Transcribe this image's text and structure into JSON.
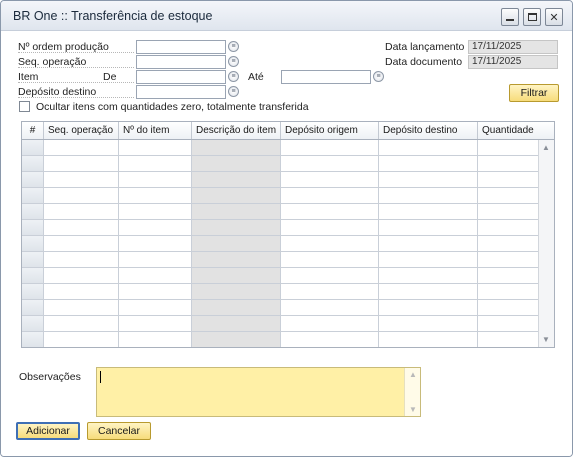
{
  "window": {
    "title": "BR One :: Transferência de estoque",
    "controls": [
      "minimize",
      "maximize",
      "close"
    ]
  },
  "form": {
    "ordem_label": "Nº ordem produção",
    "ordem_value": "",
    "seq_label": "Seq. operação",
    "seq_value": "",
    "item_label": "Item",
    "de_label": "De",
    "de_value": "",
    "ate_label": "Até",
    "ate_value": "",
    "deposito_label": "Depósito destino",
    "deposito_value": "",
    "data_lancamento_label": "Data lançamento",
    "data_lancamento_value": "17/11/2025",
    "data_documento_label": "Data documento",
    "data_documento_value": "17/11/2025",
    "ocultar_label": "Ocultar itens com quantidades zero, totalmente transferida",
    "ocultar_checked": false,
    "filtrar_label": "Filtrar"
  },
  "grid": {
    "columns": [
      "#",
      "Seq. operação",
      "Nº do item",
      "Descrição do item",
      "Depósito origem",
      "Depósito destino",
      "Quantidade"
    ],
    "rows": [
      [
        "",
        "",
        "",
        "",
        "",
        "",
        ""
      ],
      [
        "",
        "",
        "",
        "",
        "",
        "",
        ""
      ],
      [
        "",
        "",
        "",
        "",
        "",
        "",
        ""
      ],
      [
        "",
        "",
        "",
        "",
        "",
        "",
        ""
      ],
      [
        "",
        "",
        "",
        "",
        "",
        "",
        ""
      ],
      [
        "",
        "",
        "",
        "",
        "",
        "",
        ""
      ],
      [
        "",
        "",
        "",
        "",
        "",
        "",
        ""
      ],
      [
        "",
        "",
        "",
        "",
        "",
        "",
        ""
      ],
      [
        "",
        "",
        "",
        "",
        "",
        "",
        ""
      ],
      [
        "",
        "",
        "",
        "",
        "",
        "",
        ""
      ],
      [
        "",
        "",
        "",
        "",
        "",
        "",
        ""
      ],
      [
        "",
        "",
        "",
        "",
        "",
        "",
        ""
      ],
      [
        "",
        "",
        "",
        "",
        "",
        "",
        ""
      ]
    ]
  },
  "observacoes": {
    "label": "Observações",
    "value": ""
  },
  "buttons": {
    "adicionar": "Adicionar",
    "cancelar": "Cancelar"
  },
  "colors": {
    "button_gold": "#f7dc7b",
    "notes_yellow": "#fff0a6",
    "readonly_gray": "#e4e4e4",
    "primary_border": "#3f6fb5"
  }
}
